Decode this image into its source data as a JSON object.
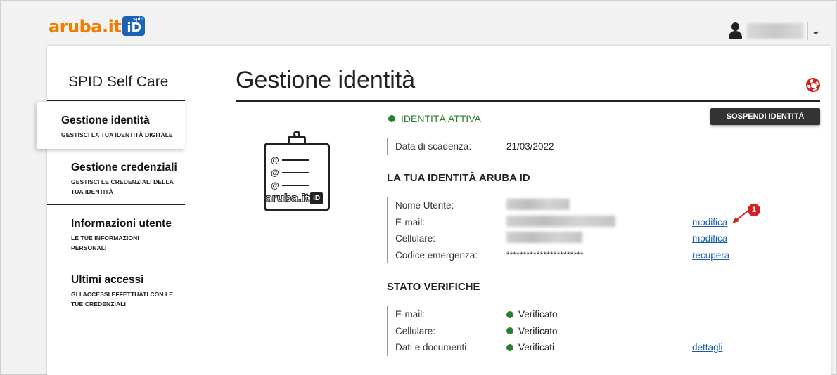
{
  "header": {
    "logo_text": "aruba.it",
    "logo_badge_small": "spid",
    "logo_badge_big": "iD"
  },
  "sidebar": {
    "title": "SPID Self Care",
    "items": [
      {
        "title": "Gestione identità",
        "subtitle": "GESTISCI LA TUA IDENTITÀ DIGITALE",
        "active": true
      },
      {
        "title": "Gestione credenziali",
        "subtitle": "GESTISCI LE CREDENZIALI DELLA TUA IDENTITÀ",
        "active": false
      },
      {
        "title": "Informazioni utente",
        "subtitle": "LE TUE INFORMAZIONI PERSONALI",
        "active": false
      },
      {
        "title": "Ultimi accessi",
        "subtitle": "GLI ACCESSI EFFETTUATI CON LE TUE CREDENZIALI",
        "active": false
      }
    ]
  },
  "main": {
    "title": "Gestione identità",
    "status": "IDENTITÀ ATTIVA",
    "suspend_label": "SOSPENDI IDENTITÀ",
    "expiry": {
      "label": "Data di scadenza:",
      "value": "21/03/2022"
    },
    "identity_section": {
      "title": "LA TUA IDENTITÀ ARUBA ID",
      "rows": [
        {
          "label": "Nome Utente:",
          "value": "",
          "action": ""
        },
        {
          "label": "E-mail:",
          "value": "",
          "action": "modifica"
        },
        {
          "label": "Cellulare:",
          "value": "",
          "action": "modifica"
        },
        {
          "label": "Codice emergenza:",
          "value": "***********************",
          "action": "recupera"
        }
      ]
    },
    "verify_section": {
      "title": "STATO VERIFICHE",
      "rows": [
        {
          "label": "E-mail:",
          "value": "Verificato",
          "action": ""
        },
        {
          "label": "Cellulare:",
          "value": "Verificato",
          "action": ""
        },
        {
          "label": "Dati e documenti:",
          "value": "Verificati",
          "action": "dettagli"
        }
      ]
    },
    "clipboard_logo": {
      "text": "aruba.it",
      "badge": "iD"
    },
    "annotation_number": "1"
  },
  "colors": {
    "brand_orange": "#f07d00",
    "brand_blue": "#1b62b8",
    "status_green": "#2e7d32",
    "link_blue": "#1a5ea8",
    "alert_red": "#d32020"
  },
  "icons": [
    "user-icon",
    "chevron-down-icon",
    "lifebuoy-icon",
    "clipboard-icon"
  ]
}
